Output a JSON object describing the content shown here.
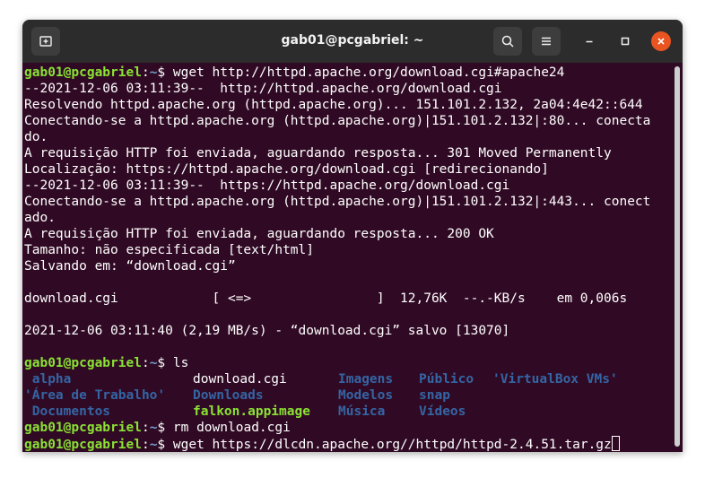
{
  "window": {
    "title": "gab01@pcgabriel: ~"
  },
  "prompt": {
    "user_host": "gab01@pcgabriel",
    "path": ":~",
    "symbol": "$ "
  },
  "commands": {
    "wget1": "wget http://httpd.apache.org/download.cgi#apache24",
    "ls": "ls",
    "rm": "rm download.cgi",
    "wget2": "wget https://dlcdn.apache.org//httpd/httpd-2.4.51.tar.gz"
  },
  "output": [
    "--2021-12-06 03:11:39--  http://httpd.apache.org/download.cgi",
    "Resolvendo httpd.apache.org (httpd.apache.org)... 151.101.2.132, 2a04:4e42::644",
    "Conectando-se a httpd.apache.org (httpd.apache.org)|151.101.2.132|:80... conecta",
    "do.",
    "A requisição HTTP foi enviada, aguardando resposta... 301 Moved Permanently",
    "Localização: https://httpd.apache.org/download.cgi [redirecionando]",
    "--2021-12-06 03:11:39--  https://httpd.apache.org/download.cgi",
    "Conectando-se a httpd.apache.org (httpd.apache.org)|151.101.2.132|:443... conect",
    "ado.",
    "A requisição HTTP foi enviada, aguardando resposta... 200 OK",
    "Tamanho: não especificada [text/html]",
    "Salvando em: “download.cgi”",
    "download.cgi            [ <=>                ]  12,76K  --.-KB/s    em 0,006s",
    "2021-12-06 03:11:40 (2,19 MB/s) - “download.cgi” salvo [13070]"
  ],
  "ls": {
    "row1": [
      " alpha",
      "download.cgi",
      "Imagens",
      "Público",
      "'VirtualBox VMs'"
    ],
    "row2": [
      "'Área de Trabalho'",
      "Downloads",
      "Modelos",
      "snap"
    ],
    "row3": [
      " Documentos",
      "falkon.appimage",
      "Música",
      "Vídeos"
    ]
  },
  "colors": {
    "terminal_bg": "#300a24",
    "prompt_user": "#8ae234",
    "prompt_path": "#729fcf",
    "directory": "#3465a4",
    "executable": "#8ae234",
    "close_button": "#e95420"
  }
}
